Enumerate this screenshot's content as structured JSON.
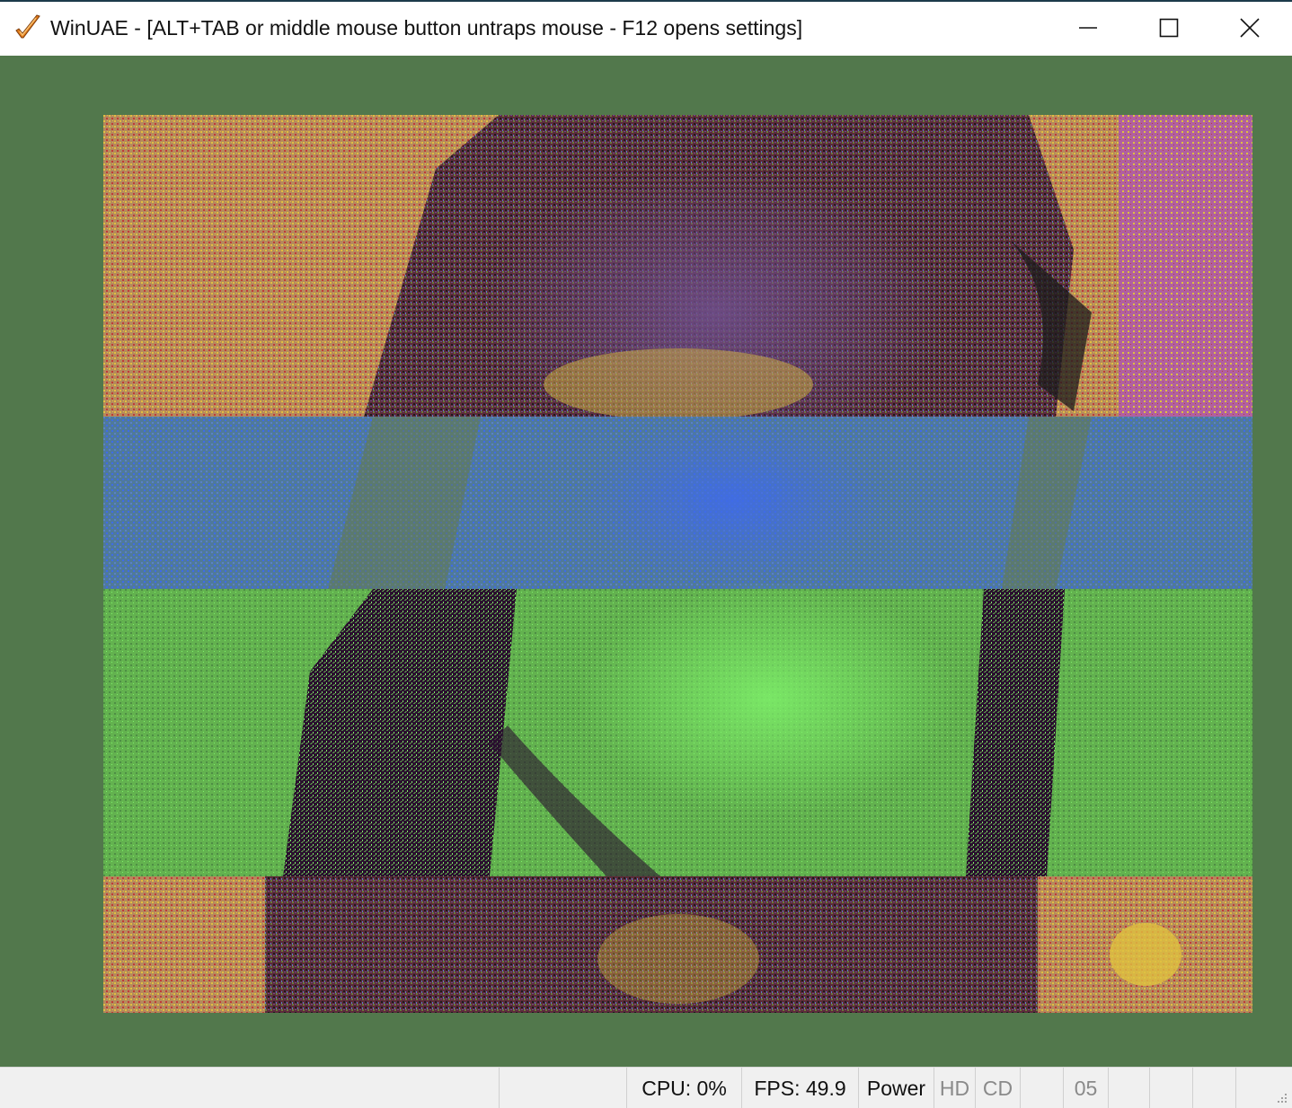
{
  "window": {
    "title": "WinUAE - [ALT+TAB or middle mouse button untraps mouse - F12 opens settings]",
    "icon": "winuae-checkmark-icon",
    "controls": {
      "minimize_icon": "minimize-icon",
      "maximize_icon": "maximize-icon",
      "close_icon": "close-icon"
    }
  },
  "colors": {
    "border_background": "#52784c",
    "statusbar_background": "#f0f0f0",
    "palette": [
      "#b58a5c",
      "#5c2a3a",
      "#6e4e8a",
      "#6b7a3a",
      "#5a80c8",
      "#3f6be8",
      "#63b24f",
      "#7ef06a",
      "#e0c040",
      "#c03a3a",
      "#b060a0",
      "#1c1c1c",
      "#2a0f2e"
    ]
  },
  "statusbar": {
    "cpu": "CPU: 0%",
    "fps": "FPS: 49.9",
    "power": "Power",
    "hd": "HD",
    "cd": "CD",
    "drive": "05"
  }
}
